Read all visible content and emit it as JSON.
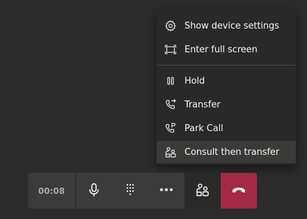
{
  "menu": {
    "items": [
      {
        "label": "Show device settings",
        "icon": "gear-icon"
      },
      {
        "label": "Enter full screen",
        "icon": "fullscreen-icon"
      },
      {
        "label": "Hold",
        "icon": "pause-icon"
      },
      {
        "label": "Transfer",
        "icon": "transfer-icon"
      },
      {
        "label": "Park Call",
        "icon": "park-call-icon"
      },
      {
        "label": "Consult then transfer",
        "icon": "consult-transfer-icon"
      }
    ]
  },
  "toolbar": {
    "timer": "00:08",
    "buttons": [
      {
        "icon": "microphone-icon"
      },
      {
        "icon": "dialpad-icon"
      },
      {
        "icon": "more-options-icon"
      },
      {
        "icon": "consult-transfer-icon"
      },
      {
        "icon": "hang-up-icon"
      }
    ]
  },
  "colors": {
    "background": "#2c2c2c",
    "menu_background": "#292929",
    "hangup": "#a52a44",
    "toolbar": "#3b3b3b"
  }
}
